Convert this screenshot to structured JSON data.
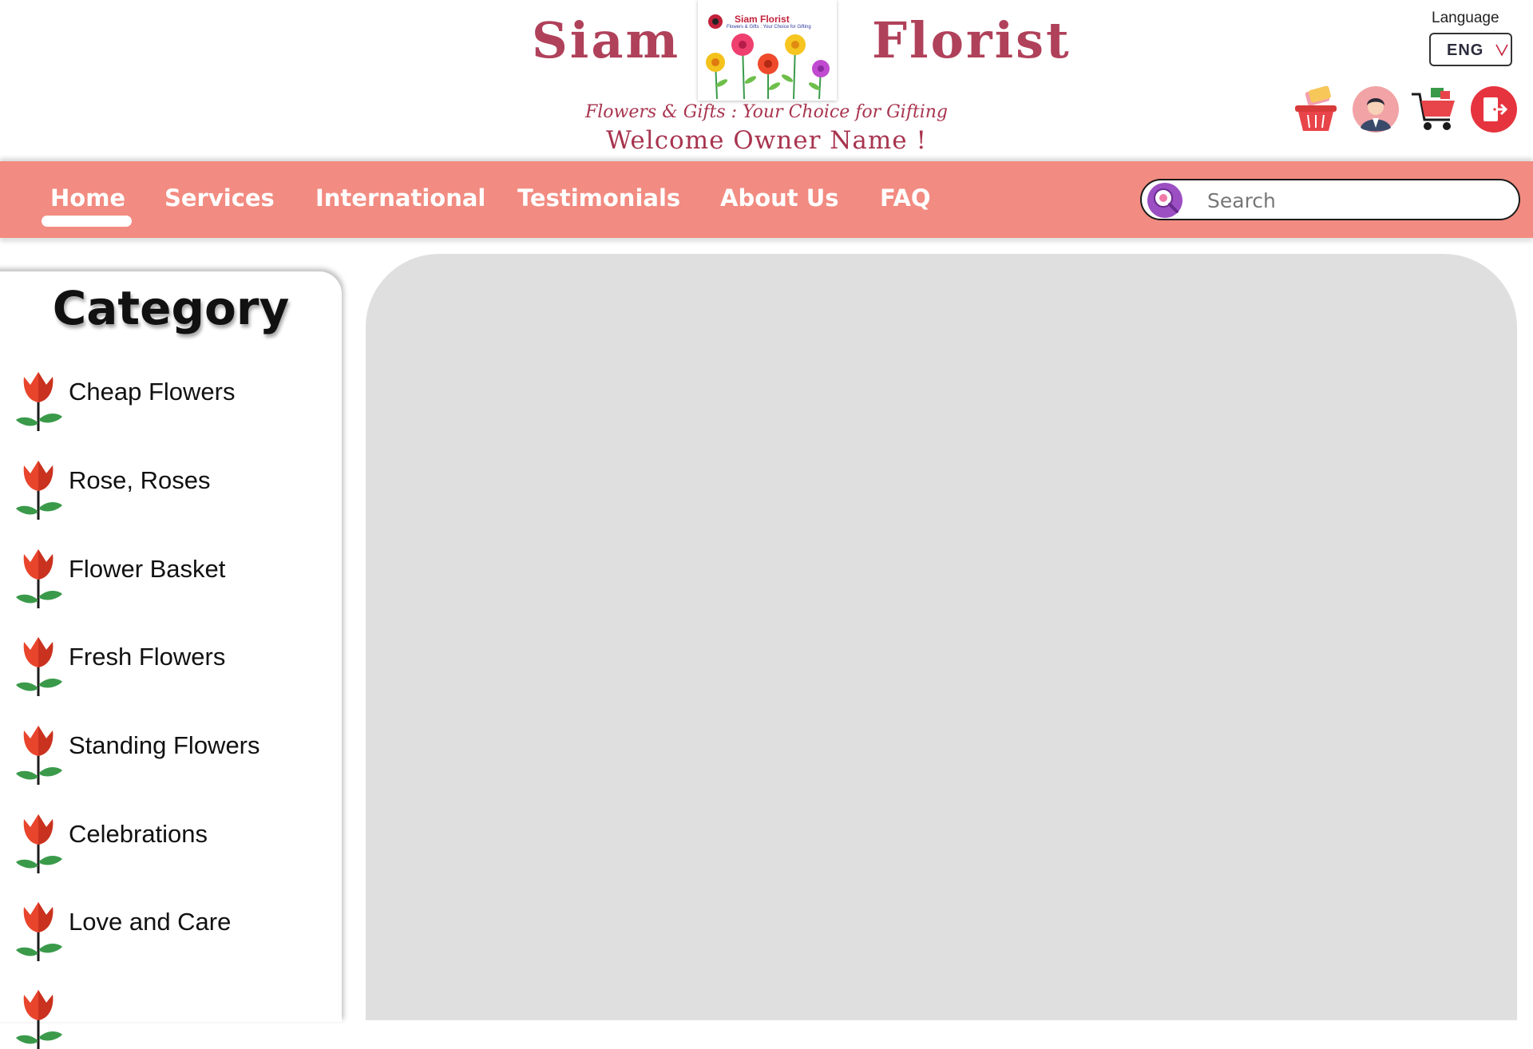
{
  "brand": {
    "word_left": "Siam",
    "word_right": "Florist",
    "logo_title": "Siam Florist",
    "logo_subtitle": "Flowers & Gifts : Your Choice for Gifting",
    "tagline": "Flowers & Gifts : Your Choice for Gifting",
    "welcome": "Welcome Owner Name !"
  },
  "language": {
    "label": "Language",
    "value": "ENG"
  },
  "header_icons": [
    "basket-icon",
    "profile-icon",
    "cart-icon",
    "logout-icon"
  ],
  "nav": {
    "items": [
      {
        "label": "Home",
        "active": true
      },
      {
        "label": "Services"
      },
      {
        "label": "International"
      },
      {
        "label": "Testimonials"
      },
      {
        "label": "About Us"
      },
      {
        "label": "FAQ"
      }
    ]
  },
  "search": {
    "placeholder": "Search"
  },
  "sidebar": {
    "title": "Category",
    "items": [
      {
        "label": "Cheap Flowers"
      },
      {
        "label": "Rose, Roses"
      },
      {
        "label": "Flower Basket"
      },
      {
        "label": "Fresh Flowers"
      },
      {
        "label": "Standing Flowers"
      },
      {
        "label": "Celebrations"
      },
      {
        "label": "Love and Care"
      }
    ]
  },
  "colors": {
    "brand": "#b0415a",
    "nav_bg": "#f28b81",
    "panel_bg": "#dfdfdf",
    "tulip_red": "#e8452c",
    "leaf_green": "#3a9a4a"
  }
}
